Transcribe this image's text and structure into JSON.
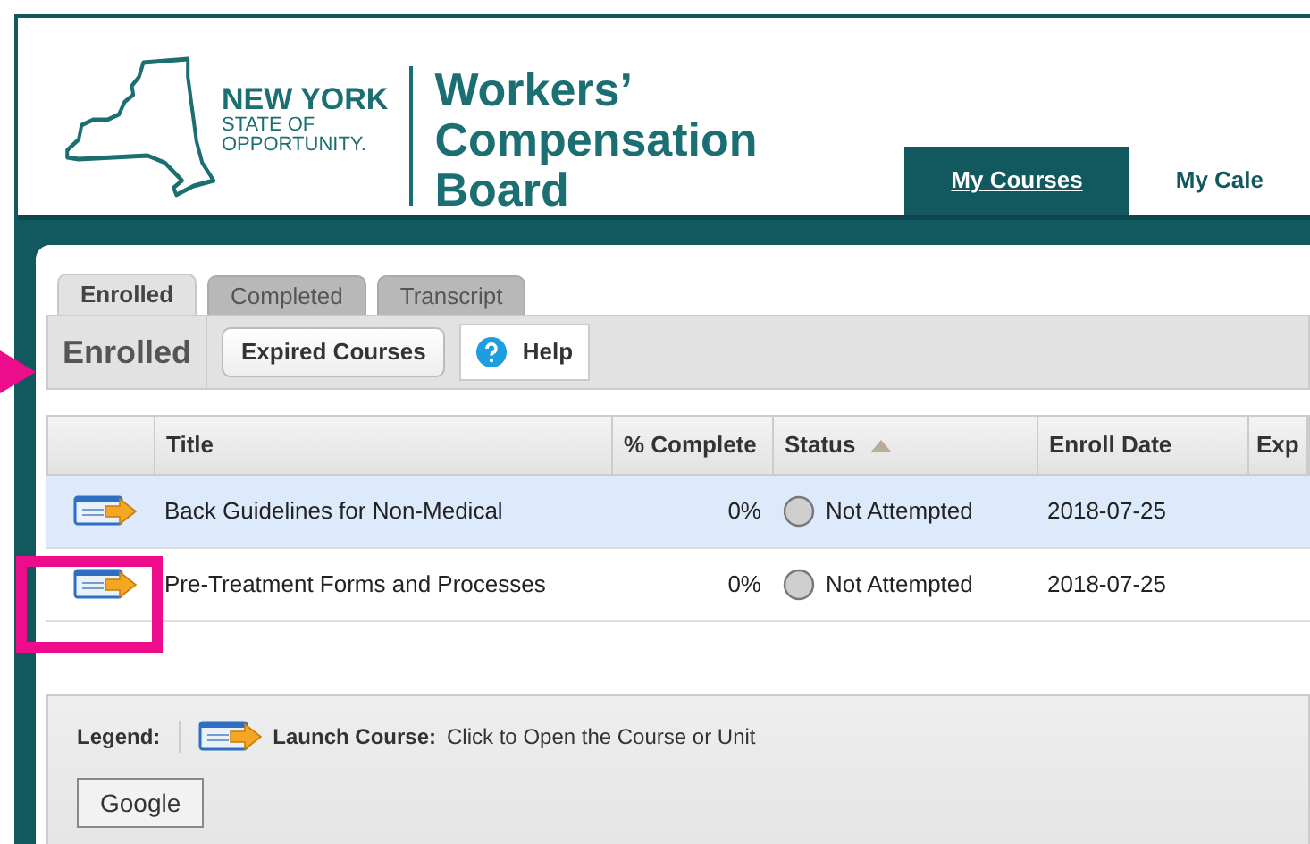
{
  "logo": {
    "state_lines": [
      "NEW YORK",
      "STATE OF",
      "OPPORTUNITY."
    ],
    "agency_lines": [
      "Workers’",
      "Compensation",
      "Board"
    ]
  },
  "nav_tabs": [
    {
      "label": "My Courses",
      "selected": true
    },
    {
      "label": "My Cale",
      "selected": false
    }
  ],
  "tabs": [
    {
      "label": "Enrolled",
      "selected": true
    },
    {
      "label": "Completed",
      "selected": false
    },
    {
      "label": "Transcript",
      "selected": false
    }
  ],
  "toolbar": {
    "title": "Enrolled",
    "buttons": [
      {
        "label": "Expired Courses",
        "kind": "plain"
      },
      {
        "label": "Help",
        "kind": "help"
      }
    ]
  },
  "table": {
    "columns": [
      {
        "label": "Title",
        "sorted": false
      },
      {
        "label": "% Complete",
        "sorted": false
      },
      {
        "label": "Status",
        "sorted": true
      },
      {
        "label": "Enroll Date",
        "sorted": false
      },
      {
        "label": "Exp",
        "sorted": false
      }
    ],
    "rows": [
      {
        "title": "Back Guidelines for Non-Medical",
        "complete": "0%",
        "status": "Not Attempted",
        "enroll_date": "2018-07-25",
        "selected": true
      },
      {
        "title": "Pre-Treatment Forms and Processes",
        "complete": "0%",
        "status": "Not Attempted",
        "enroll_date": "2018-07-25",
        "selected": false
      }
    ]
  },
  "legend": {
    "label": "Legend:",
    "item_label": "Launch Course:",
    "item_text": "Click to Open the Course or Unit"
  },
  "footer_button": "Google"
}
